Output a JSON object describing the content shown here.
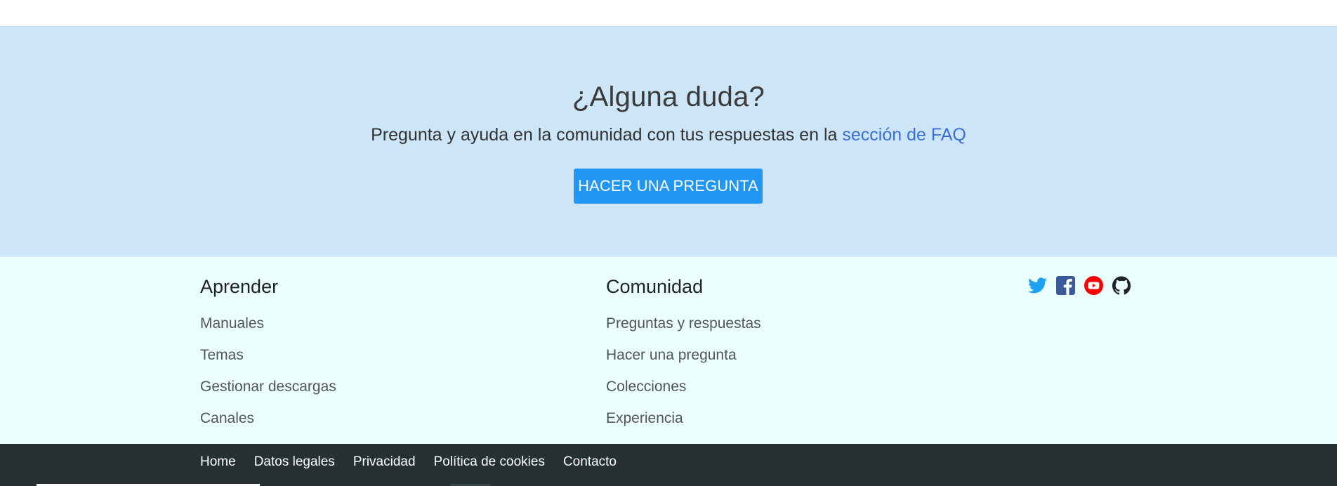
{
  "faq": {
    "title": "¿Alguna duda?",
    "text_prefix": "Pregunta y ayuda en la comunidad con tus respuestas en la ",
    "link_text": "sección de FAQ",
    "button_label": "HACER UNA PREGUNTA"
  },
  "footer": {
    "aprender": {
      "heading": "Aprender",
      "items": [
        "Manuales",
        "Temas",
        "Gestionar descargas",
        "Canales"
      ]
    },
    "comunidad": {
      "heading": "Comunidad",
      "items": [
        "Preguntas y respuestas",
        "Hacer una pregunta",
        "Colecciones",
        "Experiencia"
      ]
    },
    "social": [
      {
        "icon": "twitter-icon",
        "color": "#1da1f2"
      },
      {
        "icon": "facebook-icon",
        "color": "#3b5998"
      },
      {
        "icon": "youtube-icon",
        "color": "#ff0000"
      },
      {
        "icon": "github-icon",
        "color": "#222222"
      }
    ]
  },
  "bottom_nav": [
    "Home",
    "Datos legales",
    "Privacidad",
    "Política de cookies",
    "Contacto"
  ],
  "colors": {
    "faq_bg": "#cce6f8",
    "footer_bg": "#eafefd",
    "bottom_bg": "#263133",
    "button_bg": "#2196f3",
    "link": "#3b6fd8"
  }
}
